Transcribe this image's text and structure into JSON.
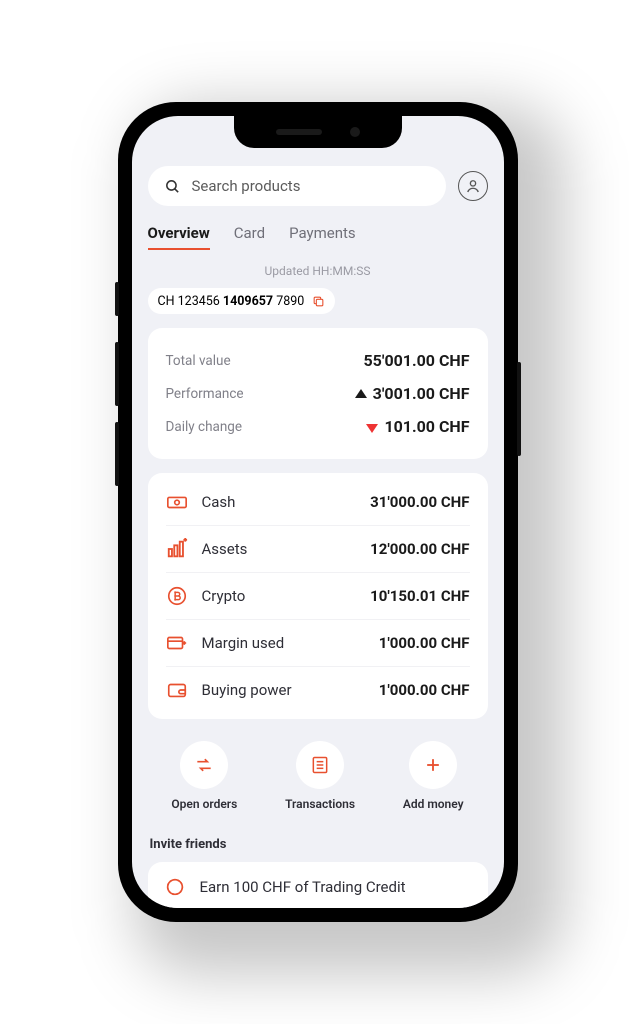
{
  "search": {
    "placeholder": "Search products"
  },
  "tabs": {
    "overview": "Overview",
    "card": "Card",
    "payments": "Payments"
  },
  "updated_label": "Updated HH:MM:SS",
  "account": {
    "prefix": "CH 123456 ",
    "bold": "1409657",
    "suffix": " 7890"
  },
  "stats": {
    "total_value": {
      "label": "Total value",
      "value": "55'001.00 CHF"
    },
    "performance": {
      "label": "Performance",
      "value": "3'001.00 CHF"
    },
    "daily_change": {
      "label": "Daily change",
      "value": "101.00 CHF"
    }
  },
  "balances": {
    "cash": {
      "label": "Cash",
      "value": "31'000.00 CHF"
    },
    "assets": {
      "label": "Assets",
      "value": "12'000.00 CHF"
    },
    "crypto": {
      "label": "Crypto",
      "value": "10'150.01 CHF"
    },
    "margin": {
      "label": "Margin used",
      "value": "1'000.00 CHF"
    },
    "buying": {
      "label": "Buying power",
      "value": "1'000.00 CHF"
    }
  },
  "actions": {
    "open_orders": "Open orders",
    "transactions": "Transactions",
    "add_money": "Add money"
  },
  "invite": {
    "heading": "Invite friends",
    "offer": "Earn 100 CHF of Trading Credit"
  }
}
